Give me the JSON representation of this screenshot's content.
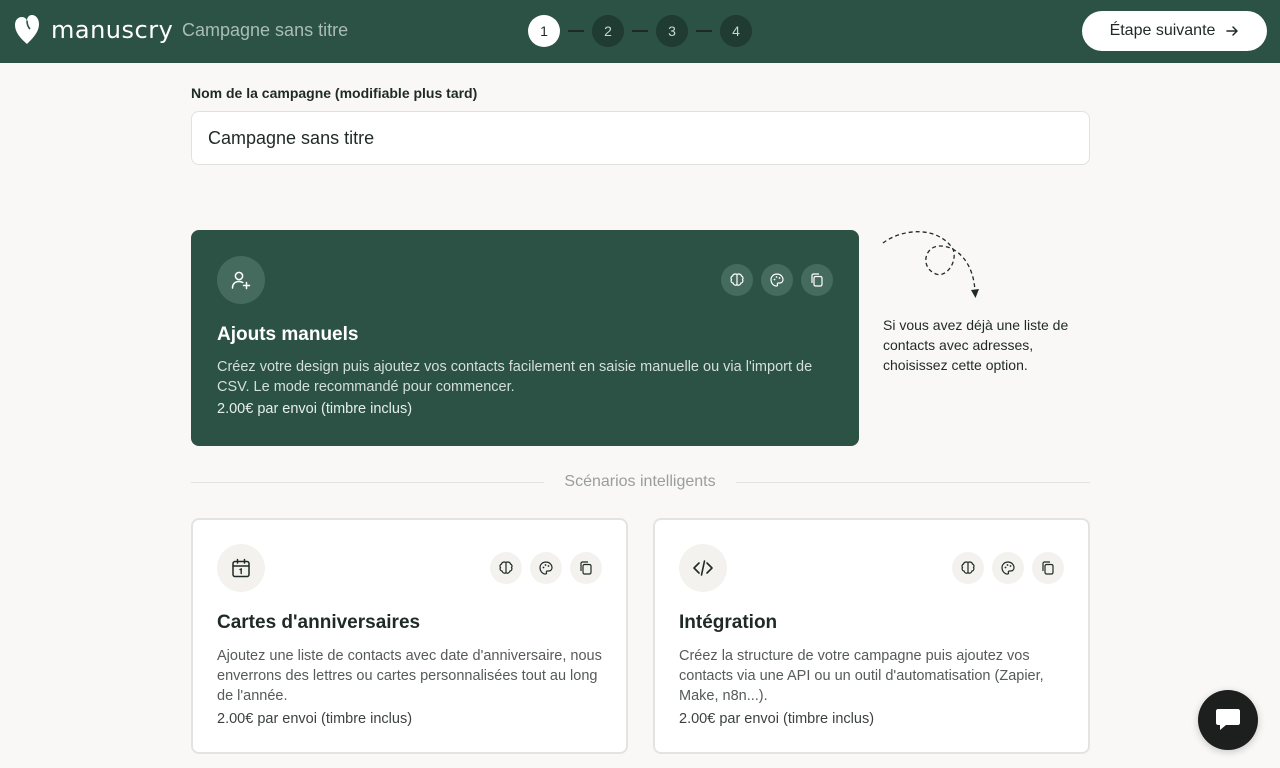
{
  "brand": {
    "name": "manuscry"
  },
  "header": {
    "campaign_title": "Campagne sans titre",
    "steps": [
      "1",
      "2",
      "3",
      "4"
    ],
    "active_step": 1,
    "next_label": "Étape suivante"
  },
  "form": {
    "name_label": "Nom de la campagne (modifiable plus tard)",
    "name_value": "Campagne sans titre"
  },
  "cards": {
    "manual": {
      "title": "Ajouts manuels",
      "description": "Créez votre design puis ajoutez vos contacts facilement en saisie manuelle ou via l'import de CSV. Le mode recommandé pour commencer.",
      "price": "2.00€ par envoi (timbre inclus)",
      "icon": "user-plus-icon"
    },
    "birthday": {
      "title": "Cartes d'anniversaires",
      "description": "Ajoutez une liste de contacts avec date d'anniversaire, nous enverrons des lettres ou cartes personnalisées tout au long de l'année.",
      "price": "2.00€ par envoi (timbre inclus)",
      "icon": "calendar-icon"
    },
    "integration": {
      "title": "Intégration",
      "description": "Créez la structure de votre campagne puis ajoutez vos contacts via une API ou un outil d'automatisation (Zapier, Make, n8n...).",
      "price": "2.00€ par envoi (timbre inclus)",
      "icon": "code-icon"
    }
  },
  "side_note": "Si vous avez déjà une liste de contacts avec adresses, choisissez cette option.",
  "divider_label": "Scénarios intelligents",
  "colors": {
    "brand_green": "#2c5245",
    "background": "#f9f8f6",
    "white": "#ffffff"
  }
}
